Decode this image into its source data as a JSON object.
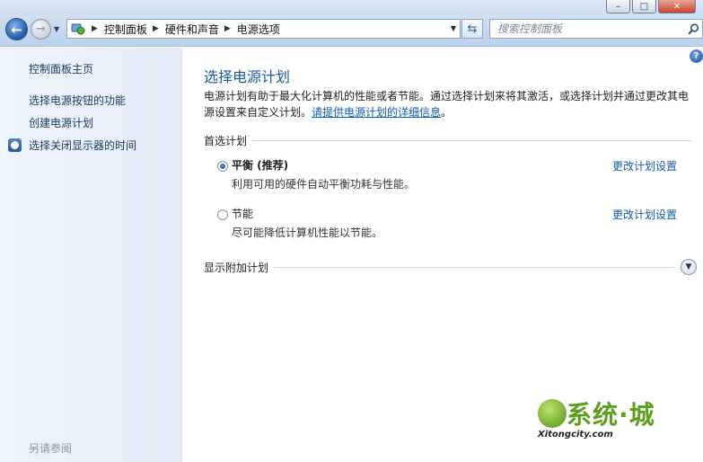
{
  "window": {
    "minimize": "–",
    "maximize": "□",
    "close": "✕"
  },
  "nav": {
    "back_icon": "back-arrow-icon",
    "forward_icon": "forward-arrow-icon"
  },
  "address": {
    "crumbs": [
      "控制面板",
      "硬件和声音",
      "电源选项"
    ]
  },
  "search": {
    "placeholder": "搜索控制面板"
  },
  "sidebar": {
    "home": "控制面板主页",
    "links": [
      "选择电源按钮的功能",
      "创建电源计划",
      "选择关闭显示器的时间"
    ],
    "see_also": "另请参阅"
  },
  "main": {
    "title": "选择电源计划",
    "description": "电源计划有助于最大化计算机的性能或者节能。通过选择计划来将其激活，或选择计划并通过更改其电源设置来自定义计划。",
    "description_link": "请提供电源计划的详细信息",
    "description_end": "。",
    "preferred_section": "首选计划",
    "plans": [
      {
        "name": "平衡 (推荐)",
        "description": "利用可用的硬件自动平衡功耗与性能。",
        "change_link": "更改计划设置",
        "selected": true
      },
      {
        "name": "节能",
        "description": "尽可能降低计算机性能以节能。",
        "change_link": "更改计划设置",
        "selected": false
      }
    ],
    "additional_section": "显示附加计划"
  },
  "watermark": {
    "text": "系统·城",
    "url": "Xitongcity.com"
  }
}
